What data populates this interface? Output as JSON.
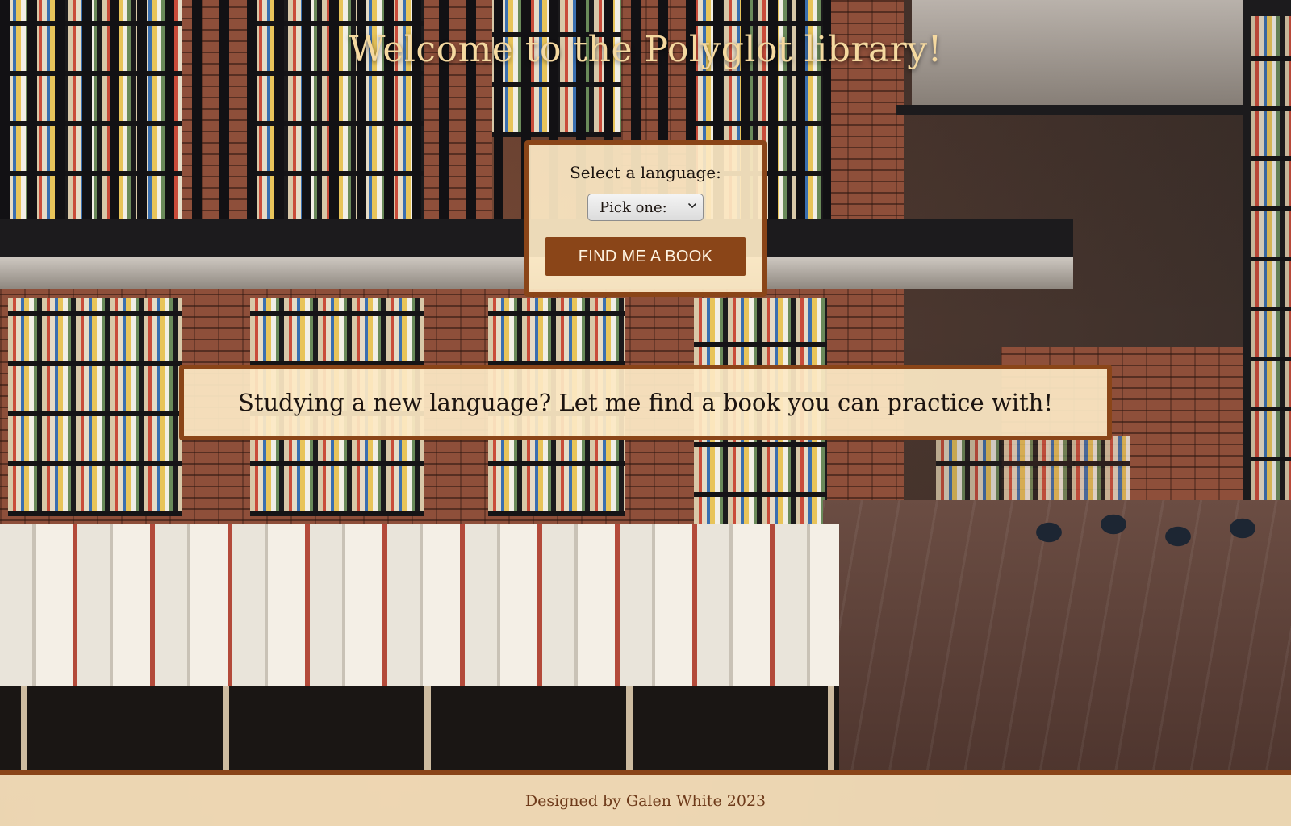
{
  "header": {
    "title": "Welcome to the Polyglot library!"
  },
  "language_picker": {
    "label": "Select a language:",
    "selected": "Pick one:",
    "options": [
      "Pick one:"
    ],
    "button_label": "FIND ME A BOOK"
  },
  "banner": {
    "text": "Studying a new language? Let me find a book you can practice with!"
  },
  "footer": {
    "credit": "Designed by Galen White 2023"
  },
  "colors": {
    "accent": "#8a4518",
    "panel_background": "#fce8c4",
    "title_text": "#f5d9a0",
    "footer_text": "#6e3a1a"
  },
  "background_image": "bookstore-interior-photo"
}
